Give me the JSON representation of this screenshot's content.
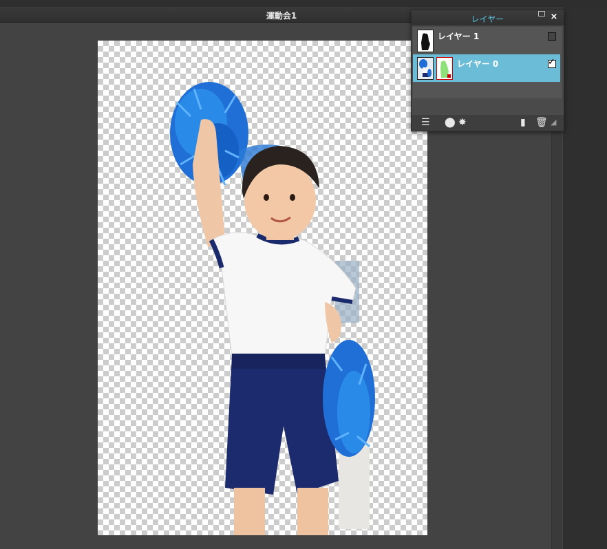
{
  "document": {
    "title": "運動会1"
  },
  "layers_panel": {
    "title": "レイヤー",
    "close_label": "×",
    "layers": [
      {
        "name": "レイヤー 1",
        "visible": false,
        "selected": false
      },
      {
        "name": "レイヤー 0",
        "visible": true,
        "selected": true
      }
    ],
    "footer_icons": [
      "layer-settings-icon",
      "mask-icon",
      "effects-icon",
      "new-layer-icon",
      "trash-icon",
      "resize-handle-icon"
    ]
  },
  "colors": {
    "accent": "#5ec6e8",
    "selected_row": "#6bbcd6",
    "app_bg": "#434343"
  }
}
